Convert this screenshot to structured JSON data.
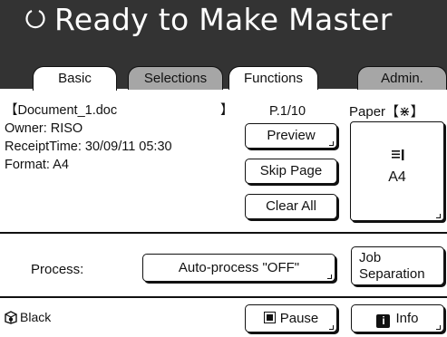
{
  "header": {
    "title": "Ready to Make Master",
    "status_icon": "ring-icon",
    "background": "#333333"
  },
  "tabs": [
    {
      "label": "Basic",
      "state": "active"
    },
    {
      "label": "Selections",
      "state": "inactive-gray"
    },
    {
      "label": "Functions",
      "state": "inactive-white"
    },
    {
      "label": "Admin.",
      "state": "inactive-gray"
    }
  ],
  "document": {
    "name_open": "【Document_1.doc",
    "name_close": "】",
    "owner": "Owner: RISO",
    "receipt_time": "ReceiptTime: 30/09/11 05:30",
    "format": "Format: A4"
  },
  "pages": {
    "label": "P.1/10"
  },
  "buttons": {
    "preview": "Preview",
    "skip_page": "Skip Page",
    "clear_all": "Clear All",
    "auto_process": "Auto-process \"OFF\"",
    "job_separation_line1": "Job",
    "job_separation_line2": "Separation",
    "pause": "Pause",
    "info": "Info"
  },
  "paper": {
    "label": "Paper【⋇】",
    "size": "A4",
    "icon": "paper-stack-icon"
  },
  "process": {
    "label": "Process:"
  },
  "footer": {
    "ink_color": "Black",
    "ink_icon": "ink-drum-icon",
    "pause_icon": "stop-square-icon",
    "info_icon": "info-icon"
  }
}
